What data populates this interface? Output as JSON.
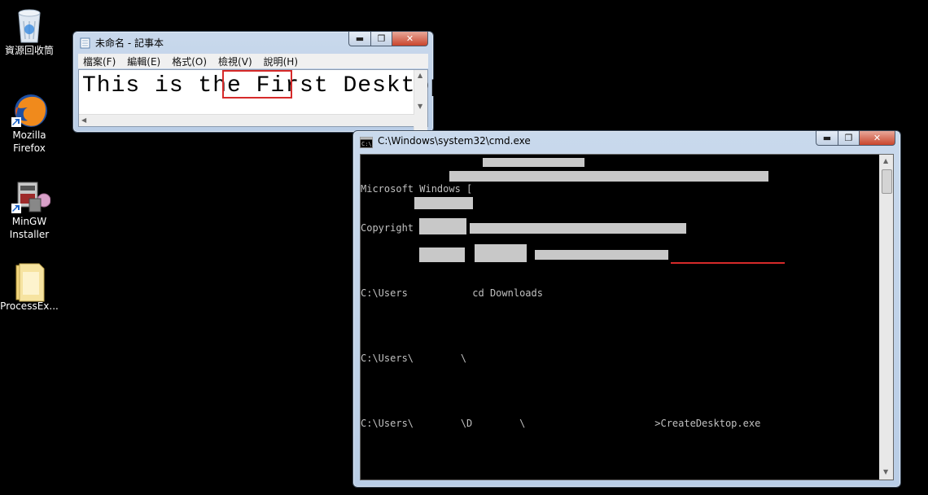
{
  "desktop": {
    "icons": [
      {
        "name": "recycle-bin",
        "label": "資源回收筒",
        "icon": "recycle-bin-icon"
      },
      {
        "name": "firefox",
        "label": "Mozilla Firefox",
        "icon": "firefox-icon"
      },
      {
        "name": "mingw",
        "label": "MinGW Installer",
        "icon": "installer-icon"
      },
      {
        "name": "processex",
        "label": "ProcessEx...",
        "icon": "folder-icon"
      }
    ]
  },
  "notepad": {
    "title": "未命名 - 記事本",
    "menus": [
      "檔案(F)",
      "編輯(E)",
      "格式(O)",
      "檢視(V)",
      "說明(H)"
    ],
    "text_before": "This is the ",
    "text_highlight": "First",
    "text_after": " Desktop",
    "highlight_color": "#d62a2a"
  },
  "cmd": {
    "title": "C:\\Windows\\system32\\cmd.exe",
    "lines": [
      "Microsoft Windows [",
      "Copyright (c)",
      "",
      "C:\\Users           cd Downloads",
      "",
      "C:\\Users\\        \\",
      "",
      "C:\\Users\\        \\D        \\                      >"
    ],
    "last_command": "CreateDesktop.exe",
    "text_color": "#c0c0c0",
    "underline_color": "#d62a2a"
  },
  "window_buttons": {
    "minimize": "▬",
    "maximize": "❐",
    "close": "✕"
  }
}
